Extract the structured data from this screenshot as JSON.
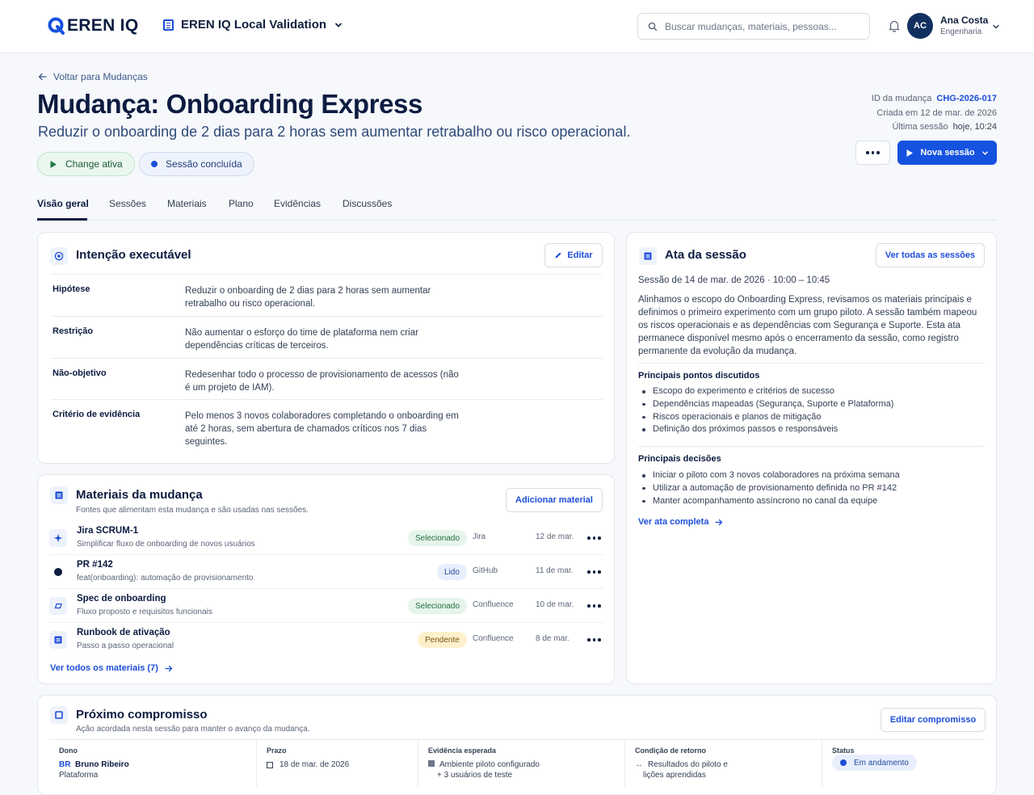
{
  "topbar": {
    "logo_text": "EREN IQ",
    "workspace": "EREN IQ Local Validation",
    "search_placeholder": "Buscar mudanças, materiais, pessoas...",
    "user": {
      "initials": "AC",
      "name": "Ana Costa",
      "role": "Engenharia"
    }
  },
  "header": {
    "back_label": "Voltar para Mudanças",
    "title": "Mudança: Onboarding Express",
    "subtitle": "Reduzir o onboarding de 2 dias para 2 horas sem aumentar retrabalho ou risco operacional.",
    "meta": {
      "id_label": "ID da mudança",
      "id_value": "CHG-2026-017",
      "created": "Criada em 12 de mar. de 2026",
      "last_label": "Última sessão",
      "last_value": "hoje, 10:24"
    },
    "primary_button": "Nova sessão",
    "pills": {
      "change": "Change ativa",
      "session": "Sessão concluída"
    }
  },
  "tabs": [
    "Visão geral",
    "Sessões",
    "Materiais",
    "Plano",
    "Evidências",
    "Discussões"
  ],
  "intencao": {
    "title": "Intenção executável",
    "edit_label": "Editar",
    "rows": [
      {
        "label": "Hipótese",
        "text": "Reduzir o onboarding de 2 dias para 2 horas sem aumentar retrabalho ou risco operacional."
      },
      {
        "label": "Restrição",
        "text": "Não aumentar o esforço do time de plataforma nem criar dependências críticas de terceiros."
      },
      {
        "label": "Não-objetivo",
        "text": "Redesenhar todo o processo de provisionamento de acessos (não é um projeto de IAM)."
      },
      {
        "label": "Critério de evidência",
        "text": "Pelo menos 3 novos colaboradores completando o onboarding em até 2 horas, sem abertura de chamados críticos nos 7 dias seguintes."
      }
    ]
  },
  "materiais": {
    "title": "Materiais da mudança",
    "subtitle": "Fontes que alimentam esta mudança e são usadas nas sessões.",
    "add_label": "Adicionar material",
    "items": [
      {
        "title": "Jira SCRUM-1",
        "desc": "Simplificar fluxo de onboarding de novos usuários",
        "badge": "Selecionado",
        "source": "Jira",
        "date": "12 de mar.",
        "icon": "jira-icon"
      },
      {
        "title": "PR #142",
        "desc": "feat(onboarding): automação de provisionamento",
        "badge": "Lido",
        "source": "GitHub",
        "date": "11 de mar.",
        "icon": "github-icon"
      },
      {
        "title": "Spec de onboarding",
        "desc": "Fluxo proposto e requisitos funcionais",
        "badge": "Selecionado",
        "source": "Confluence",
        "date": "10 de mar.",
        "icon": "confluence-icon"
      },
      {
        "title": "Runbook de ativação",
        "desc": "Passo a passo operacional",
        "badge": "Pendente",
        "source": "Confluence",
        "date": "8 de mar.",
        "icon": "document-icon"
      }
    ],
    "view_all": "Ver todos os materiais (7)"
  },
  "ata": {
    "title": "Ata da sessão",
    "view_all": "Ver todas as sessões",
    "date": "Sessão de 14 de mar. de 2026 · 10:00 – 10:45",
    "summary": "Alinhamos o escopo do Onboarding Express, revisamos os materiais principais e definimos o primeiro experimento com um grupo piloto. A sessão também mapeou os riscos operacionais e as dependências com Segurança e Suporte. Esta ata permanece disponível mesmo após o encerramento da sessão, como registro permanente da evolução da mudança.",
    "points_title": "Principais pontos discutidos",
    "points": [
      "Escopo do experimento e critérios de sucesso",
      "Dependências mapeadas (Segurança, Suporte e Plataforma)",
      "Riscos operacionais e planos de mitigação",
      "Definição dos próximos passos e responsáveis"
    ],
    "decisions_title": "Principais decisões",
    "decisions": [
      "Iniciar o piloto com 3 novos colaboradores na próxima semana",
      "Utilizar a automação de provisionamento definida no PR #142",
      "Manter acompanhamento assíncrono no canal da equipe"
    ],
    "full_link": "Ver ata completa"
  },
  "compromisso": {
    "title": "Próximo compromisso",
    "subtitle": "Ação acordada nesta sessão para manter o avanço da mudança.",
    "edit_label": "Editar compromisso",
    "owner_h": "Dono",
    "owner_initials": "BR",
    "owner_name": "Bruno Ribeiro",
    "owner_team": "Plataforma",
    "deadline_h": "Prazo",
    "deadline": "18 de mar. de 2026",
    "evidence_h": "Evidência esperada",
    "evidence_1": "Ambiente piloto configurado",
    "evidence_2": "+ 3 usuários de teste",
    "return_h": "Condição de retorno",
    "return_1": "Resultados do piloto e",
    "return_2": "lições aprendidas",
    "status_h": "Status",
    "status": "Em andamento"
  },
  "colors": {
    "accent": "#1652e0",
    "navy": "#0c1b40",
    "link": "#1d4ed8"
  }
}
